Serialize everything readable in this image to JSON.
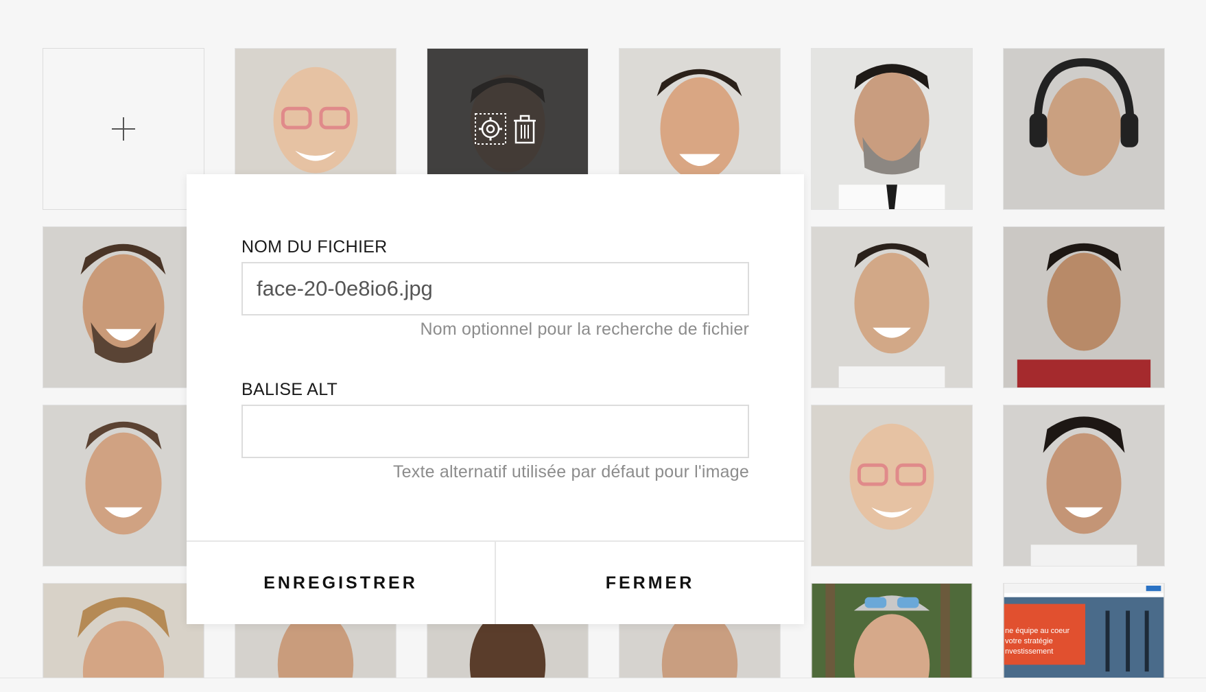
{
  "gallery": {
    "add_tile": {
      "icon": "plus-icon"
    },
    "hovered_tile": {
      "icons": [
        "gear-icon",
        "trash-icon"
      ]
    },
    "photo_labels": [
      "bald man with red glasses",
      "man with short dark hair",
      "laughing man with stubble",
      "man with grey beard and tie",
      "man with headphones",
      "laughing bearded man",
      "smiling man",
      "smiling man with dark hair",
      "smiling man",
      "bald man with red glasses",
      "smiling curly haired man",
      "man with sunglasses on head",
      "website screenshot"
    ],
    "website_thumb_text": [
      "ne équipe au coeur",
      "votre stratégie",
      "nvestissement"
    ]
  },
  "modal": {
    "filename_label": "NOM DU FICHIER",
    "filename_value": "face-20-0e8io6.jpg",
    "filename_help": "Nom optionnel pour la recherche de fichier",
    "alt_label": "BALISE ALT",
    "alt_value": "",
    "alt_help": "Texte alternatif utilisée par défaut pour l'image",
    "save_label": "ENREGISTRER",
    "close_label": "FERMER"
  },
  "colors": {
    "overlay": "#282828",
    "modal_bg": "#ffffff",
    "page_bg": "#f6f6f6"
  }
}
